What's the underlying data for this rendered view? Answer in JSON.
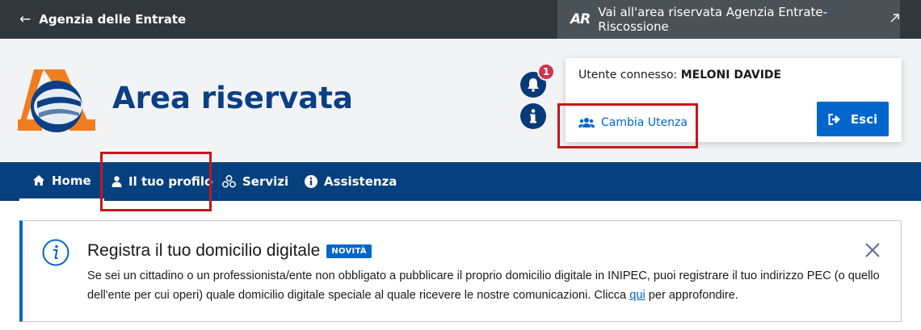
{
  "topbar": {
    "back_label": "Agenzia delle Entrate",
    "ar_logo": "AR",
    "ar_link_label": "Vai all'area riservata Agenzia Entrate-Riscossione"
  },
  "header": {
    "title": "Area riservata",
    "notification_count": "1",
    "user_label": "Utente connesso:",
    "user_name": "MELONI DAVIDE",
    "change_user_label": "Cambia Utenza",
    "logout_label": "Esci"
  },
  "nav": {
    "items": [
      {
        "label": "Home",
        "icon": "home-icon",
        "active": true
      },
      {
        "label": "Il tuo profilo",
        "icon": "user-icon"
      },
      {
        "label": "Servizi",
        "icon": "services-icon"
      },
      {
        "label": "Assistenza",
        "icon": "info-icon"
      }
    ]
  },
  "alert": {
    "title": "Registra il tuo domicilio digitale",
    "badge": "NOVITÀ",
    "body_before_link": "Se sei un cittadino o un professionista/ente non obbligato a pubblicare il proprio domicilio digitale in INIPEC, puoi registrare il tuo indirizzo PEC (o quello dell'ente per cui operi) quale domicilio digitale speciale al quale ricevere le nostre comunicazioni. Clicca ",
    "link_label": "qui",
    "body_after_link": " per approfondire."
  },
  "colors": {
    "topbar": "#30373d",
    "header_bg": "#f2f3f5",
    "nav_bg": "#06407e",
    "primary": "#0066cc",
    "title": "#0b3f86",
    "highlight": "#c4161c",
    "badge": "#d1344c"
  }
}
